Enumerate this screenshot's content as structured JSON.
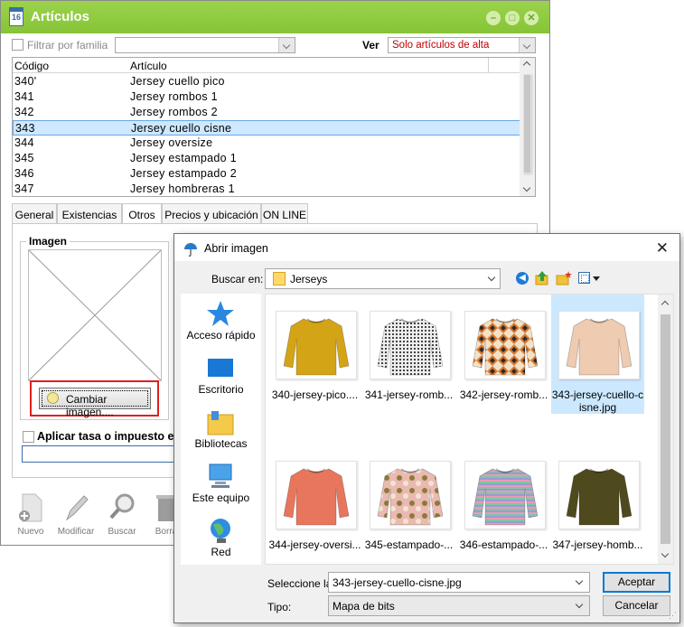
{
  "main_window": {
    "title": "Artículos",
    "app_icon_text": "16",
    "min_glyph": "–",
    "max_glyph": "□",
    "close_glyph": "✕",
    "filter_label": "Filtrar por familia",
    "ver_label": "Ver",
    "ver_value": "Solo artículos de alta",
    "ver_value_color": "#c00000",
    "list": {
      "columns": [
        "Código",
        "Artículo"
      ],
      "rows": [
        {
          "code": "340'",
          "name": "Jersey cuello pico"
        },
        {
          "code": "341",
          "name": "Jersey rombos 1"
        },
        {
          "code": "342",
          "name": "Jersey rombos 2"
        },
        {
          "code": "343",
          "name": "Jersey cuello cisne",
          "selected": true
        },
        {
          "code": "344",
          "name": "Jersey oversize"
        },
        {
          "code": "345",
          "name": "Jersey estampado 1"
        },
        {
          "code": "346",
          "name": "Jersey estampado 2"
        },
        {
          "code": "347",
          "name": "Jersey hombreras 1"
        }
      ]
    },
    "tabs": [
      "General",
      "Existencias",
      "Otros",
      "Precios y ubicación",
      "ON LINE"
    ],
    "active_tab": "Otros",
    "imagen_group_label": "Imagen",
    "change_image_button": "Cambiar imagen....",
    "tax_label": "Aplicar tasa o impuesto esp",
    "toolbar": [
      "Nuevo",
      "Modificar",
      "Buscar",
      "Borra"
    ]
  },
  "dialog": {
    "title": "Abrir imagen",
    "close_glyph": "✕",
    "look_in_label": "Buscar en:",
    "look_in_value": "Jerseys",
    "places": [
      "Acceso rápido",
      "Escritorio",
      "Bibliotecas",
      "Este equipo",
      "Red"
    ],
    "files": [
      {
        "name": "340-jersey-pico....",
        "color": "#d4a417",
        "style": "solid"
      },
      {
        "name": "341-jersey-romb...",
        "color": "#7a7a7a",
        "style": "knit"
      },
      {
        "name": "342-jersey-romb...",
        "color": "#d9782f",
        "style": "argyle"
      },
      {
        "name": "343-jersey-cuello-cisne.jpg",
        "color": "#efcbb1",
        "style": "solid",
        "selected": true
      },
      {
        "name": "344-jersey-oversi...",
        "color": "#e8765d",
        "style": "solid"
      },
      {
        "name": "345-estampado-...",
        "color": "#d8a9a2",
        "style": "camo"
      },
      {
        "name": "346-estampado-...",
        "color": "#8f8fc2",
        "style": "stripes"
      },
      {
        "name": "347-jersey-homb...",
        "color": "#4f4a1d",
        "style": "solid"
      }
    ],
    "filename_label": "Seleccione la",
    "filename_value": "343-jersey-cuello-cisne.jpg",
    "type_label": "Tipo:",
    "type_value": "Mapa de bits",
    "accept_button": "Aceptar",
    "cancel_button": "Cancelar"
  },
  "colors": {
    "title_green": "#8cc63f",
    "highlight_red": "#e0201f",
    "selection_blue": "#cde8ff"
  }
}
